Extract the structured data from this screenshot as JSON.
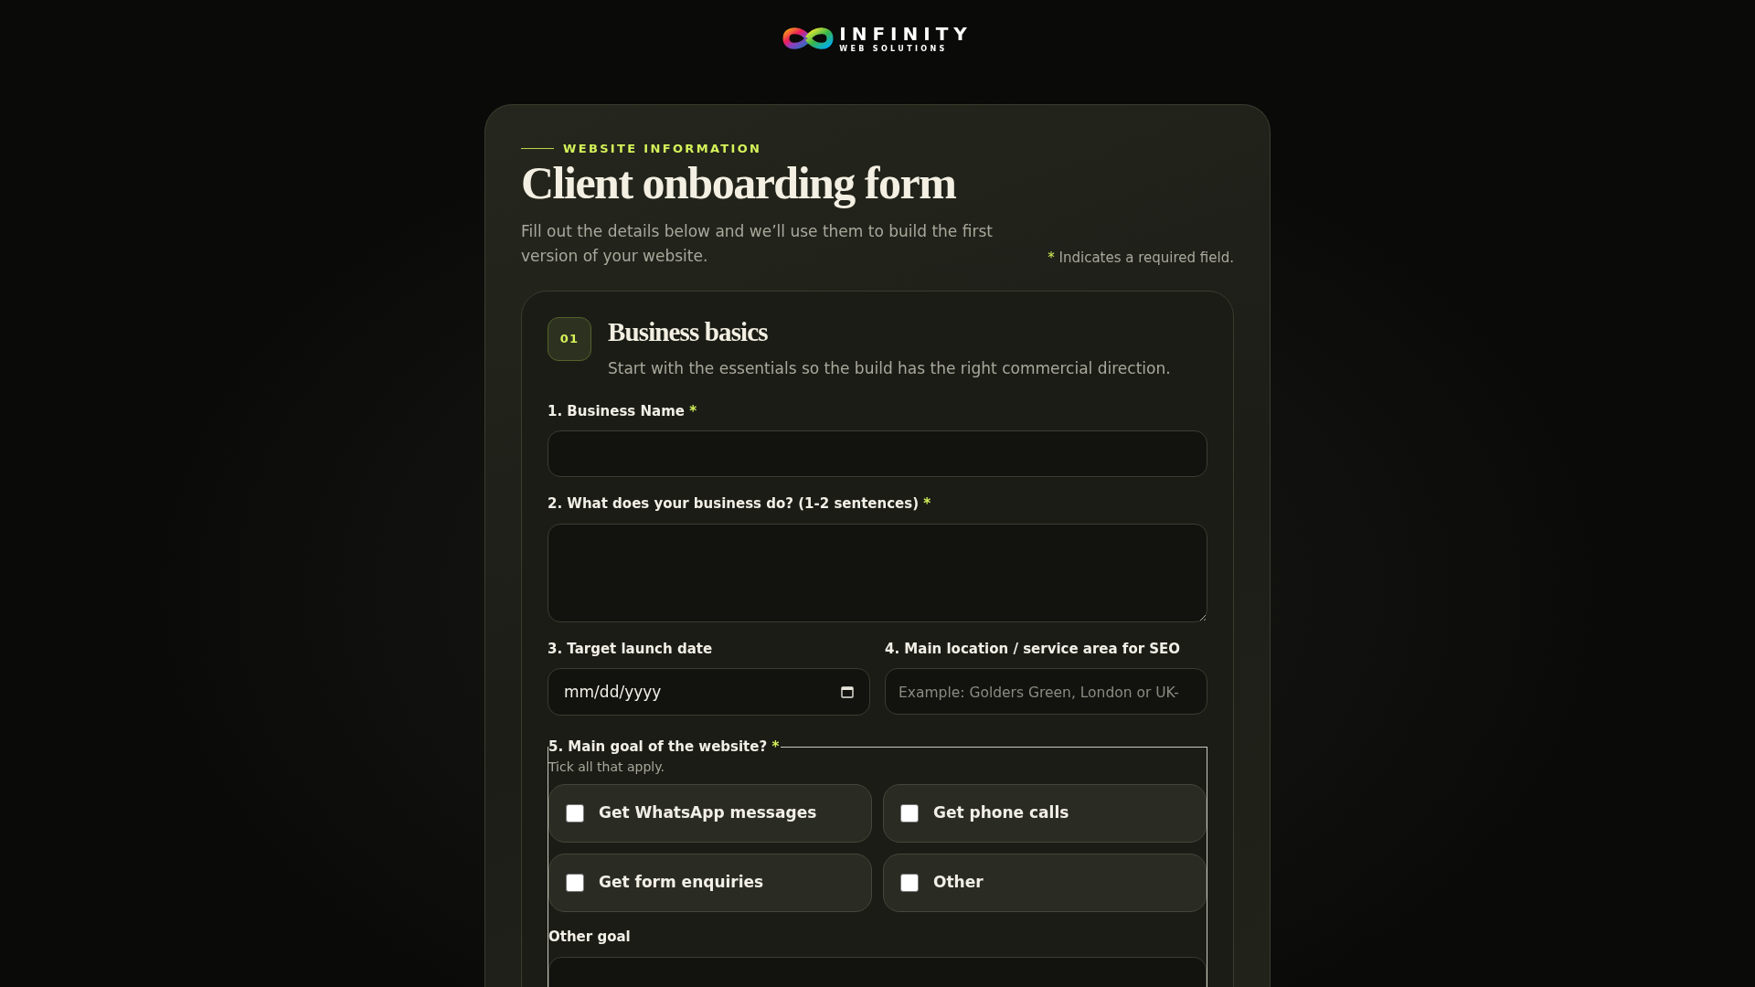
{
  "logo": {
    "name": "INFINITY",
    "tagline": "WEB SOLUTIONS"
  },
  "required_mark": "*",
  "header": {
    "eyebrow": "WEBSITE INFORMATION",
    "title": "Client onboarding form",
    "intro": "Fill out the details below and we’ll use them to build the first version of your website.",
    "required_note": "Indicates a required field."
  },
  "section": {
    "number": "01",
    "title": "Business basics",
    "description": "Start with the essentials so the build has the right commercial direction.",
    "fields": [
      {
        "kind": "text",
        "label": "1. Business Name",
        "required": true
      },
      {
        "kind": "textarea",
        "label": "2. What does your business do? (1-2 sentences)",
        "required": true
      },
      {
        "kind": "row",
        "items": [
          {
            "kind": "date",
            "label": "3. Target launch date",
            "required": false,
            "placeholder": "mm/dd/yyyy"
          },
          {
            "kind": "text",
            "label": "4. Main location / service area for SEO",
            "required": false,
            "placeholder": "Example: Golders Green, London or UK-"
          }
        ]
      },
      {
        "kind": "checkgroup",
        "label": "5. Main goal of the website?",
        "required": true,
        "hint": "Tick all that apply.",
        "options": [
          {
            "label": "Get WhatsApp messages",
            "checked": false
          },
          {
            "label": "Get phone calls",
            "checked": false
          },
          {
            "label": "Get form enquiries",
            "checked": false
          },
          {
            "label": "Other",
            "checked": false
          }
        ],
        "other": {
          "label": "Other goal"
        }
      }
    ]
  }
}
